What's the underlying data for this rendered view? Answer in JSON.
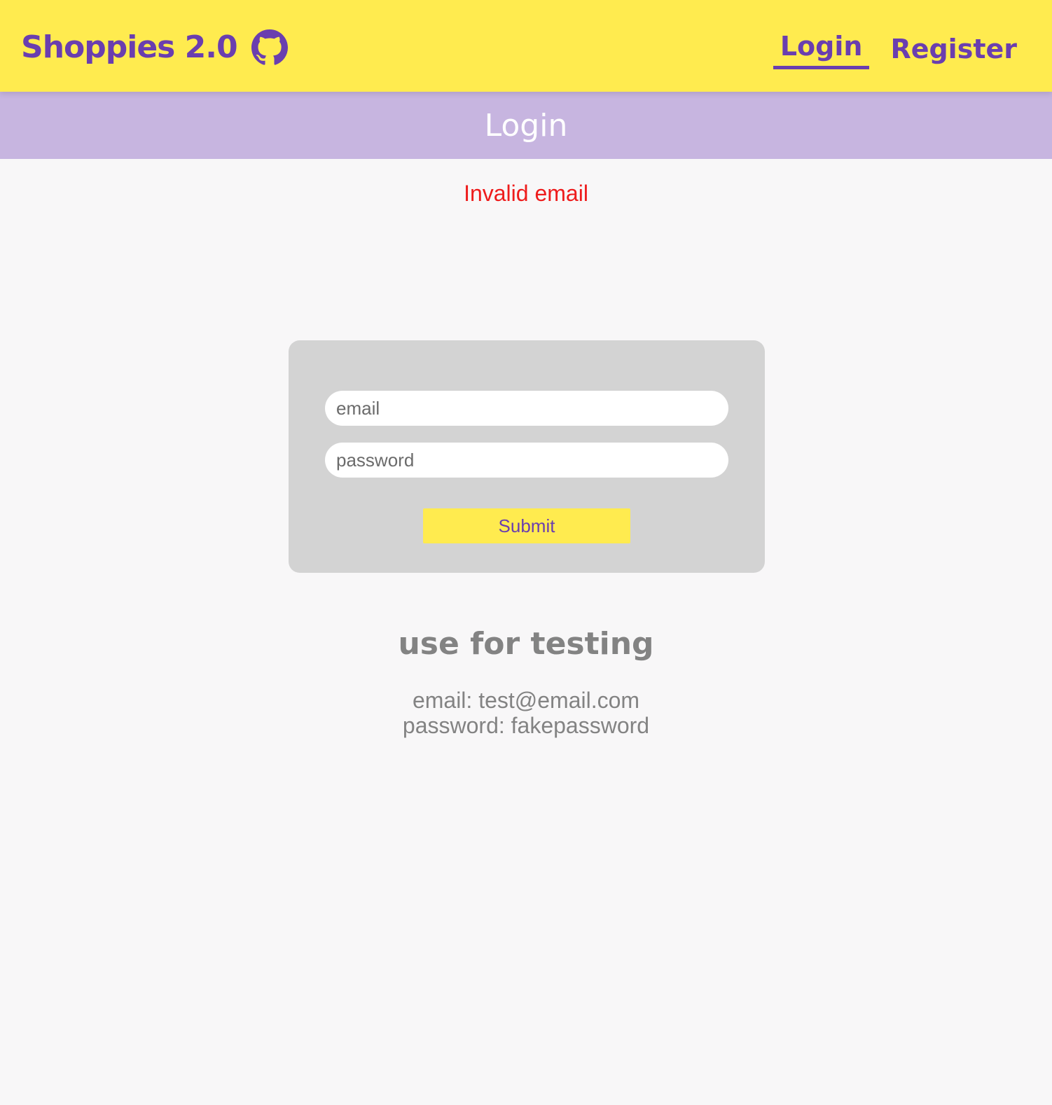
{
  "header": {
    "brand_title": "Shoppies 2.0",
    "brand_icon": "github-icon",
    "nav": {
      "login_label": "Login",
      "register_label": "Register",
      "active": "Login"
    }
  },
  "banner": {
    "title": "Login"
  },
  "error": {
    "message": "Invalid email"
  },
  "form": {
    "email_placeholder": "email",
    "email_value": "",
    "password_placeholder": "password",
    "password_value": "",
    "submit_label": "Submit"
  },
  "testing": {
    "heading": "use for testing",
    "email_line": "email: test@email.com",
    "password_line": "password: fakepassword"
  },
  "colors": {
    "header_bg": "#ffeb4f",
    "accent_purple": "#6a3eaf",
    "banner_bg": "#c7b5e0",
    "error_red": "#ee1c1c",
    "card_bg": "#d3d3d3",
    "page_bg": "#f8f7f8",
    "muted_text": "#838383"
  }
}
